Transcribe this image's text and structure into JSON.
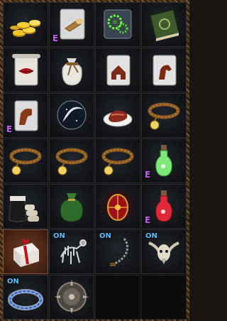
{
  "inventory": {
    "slots": [
      {
        "icon": "gold-coins-icon",
        "badge_e": "",
        "badge_on": ""
      },
      {
        "icon": "scroll-horn-icon",
        "badge_e": "E",
        "badge_on": ""
      },
      {
        "icon": "green-gears-card-icon",
        "badge_e": "",
        "badge_on": ""
      },
      {
        "icon": "green-book-icon",
        "badge_e": "",
        "badge_on": ""
      },
      {
        "icon": "lips-scroll-icon",
        "badge_e": "",
        "badge_on": ""
      },
      {
        "icon": "white-sack-icon",
        "badge_e": "",
        "badge_on": ""
      },
      {
        "icon": "house-scroll-icon",
        "badge_e": "",
        "badge_on": ""
      },
      {
        "icon": "horse-scroll-icon",
        "badge_e": "",
        "badge_on": ""
      },
      {
        "icon": "mount-scroll-icon",
        "badge_e": "E",
        "badge_on": ""
      },
      {
        "icon": "moon-orb-icon",
        "badge_e": "",
        "badge_on": ""
      },
      {
        "icon": "meat-plate-icon",
        "badge_e": "",
        "badge_on": ""
      },
      {
        "icon": "collar-icon",
        "badge_e": "",
        "badge_on": ""
      },
      {
        "icon": "collar-icon",
        "badge_e": "",
        "badge_on": ""
      },
      {
        "icon": "collar-icon",
        "badge_e": "",
        "badge_on": ""
      },
      {
        "icon": "collar-icon",
        "badge_e": "",
        "badge_on": ""
      },
      {
        "icon": "green-potion-icon",
        "badge_e": "E",
        "badge_on": ""
      },
      {
        "icon": "jar-sacks-icon",
        "badge_e": "",
        "badge_on": ""
      },
      {
        "icon": "green-bag-icon",
        "badge_e": "",
        "badge_on": ""
      },
      {
        "icon": "red-egg-icon",
        "badge_e": "",
        "badge_on": ""
      },
      {
        "icon": "red-potion-icon",
        "badge_e": "E",
        "badge_on": ""
      },
      {
        "icon": "gift-box-icon",
        "badge_e": "",
        "badge_on": "",
        "selected": true
      },
      {
        "icon": "skeleton-pet-icon",
        "badge_e": "",
        "badge_on": "ON"
      },
      {
        "icon": "chain-whip-icon",
        "badge_e": "",
        "badge_on": "ON"
      },
      {
        "icon": "horned-skull-icon",
        "badge_e": "",
        "badge_on": "ON"
      },
      {
        "icon": "blue-ring-icon",
        "badge_e": "",
        "badge_on": "ON"
      },
      {
        "icon": "spiked-shield-icon",
        "badge_e": "",
        "badge_on": ""
      },
      {
        "icon": "",
        "badge_e": "",
        "badge_on": ""
      },
      {
        "icon": "",
        "badge_e": "",
        "badge_on": ""
      }
    ]
  },
  "colors": {
    "badge_e": "#c85cff",
    "badge_on": "#4fc3ff",
    "selected_bg": "#5a2e1c",
    "frame": "#5a3e22"
  }
}
